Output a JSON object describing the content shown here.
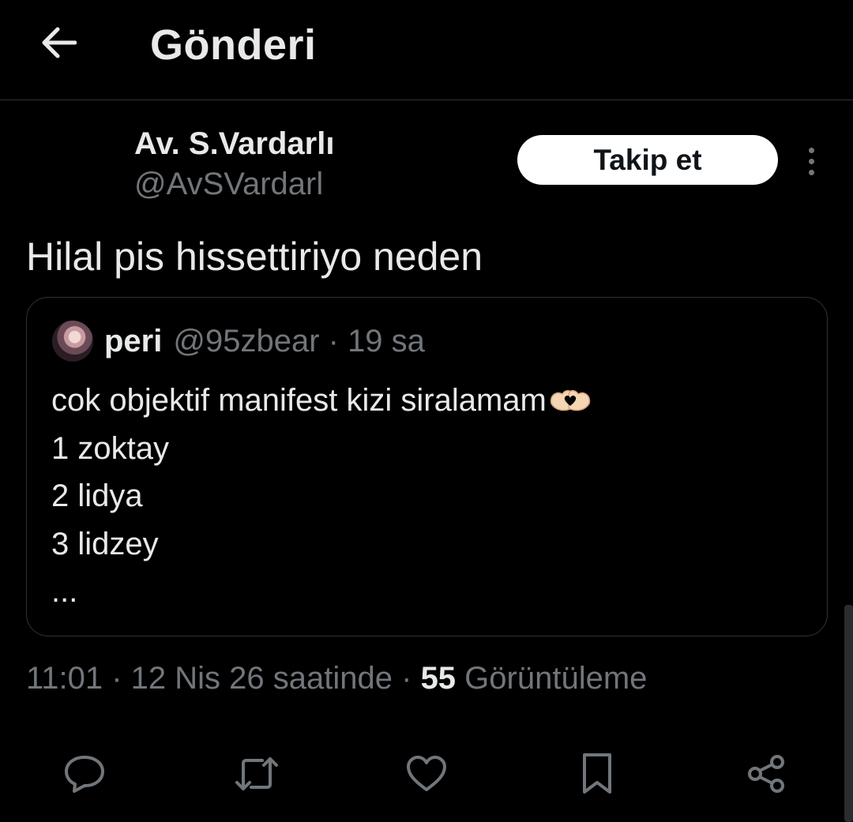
{
  "header": {
    "title": "Gönderi",
    "back_icon": "arrow-left-icon"
  },
  "post": {
    "author_name": "Av. S.Vardarlı",
    "author_handle": "@AvSVardarl",
    "follow_label": "Takip et",
    "text": "Hilal pis hissettiriyo neden",
    "timestamp": "11:01 · 12 Nis 26 saatinde",
    "separator": " · ",
    "views_count": "55",
    "views_label": " Görüntüleme"
  },
  "quote": {
    "name": "peri",
    "meta": "@95zbear · 19 sa",
    "lines": [
      "cok objektif manifest kizi siralamam",
      "1 zoktay",
      "2 lidya",
      "3 lidzey",
      "..."
    ],
    "emoji_icon": "heart-hands-icon"
  },
  "actions": {
    "icons": [
      "reply-icon",
      "retweet-icon",
      "like-icon",
      "bookmark-icon",
      "share-icon"
    ]
  },
  "colors": {
    "background": "#000000",
    "text_primary": "#e7e9ea",
    "text_secondary": "#71767b",
    "border": "#2f3336",
    "follow_bg": "#ffffff"
  }
}
